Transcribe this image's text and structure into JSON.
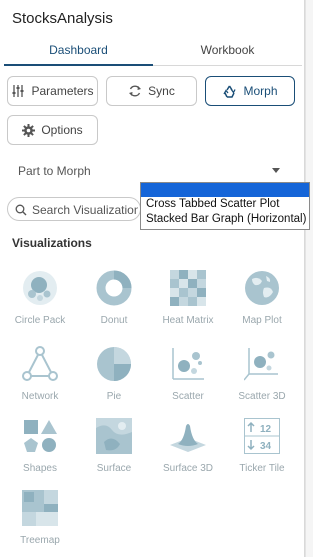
{
  "app": {
    "title": "StocksAnalysis"
  },
  "tabs": [
    {
      "label": "Dashboard",
      "active": true
    },
    {
      "label": "Workbook",
      "active": false
    }
  ],
  "toolbar": {
    "parameters_label": "Parameters",
    "sync_label": "Sync",
    "morph_label": "Morph",
    "options_label": "Options"
  },
  "morph": {
    "label": "Part to Morph",
    "options": [
      "Cross Tabbed Scatter Plot",
      "Stacked Bar Graph (Horizontal)"
    ]
  },
  "search": {
    "placeholder": "Search Visualization"
  },
  "visualizations": {
    "heading": "Visualizations",
    "items": [
      {
        "label": "Circle Pack",
        "icon": "circle-pack-icon"
      },
      {
        "label": "Donut",
        "icon": "donut-icon"
      },
      {
        "label": "Heat Matrix",
        "icon": "heat-matrix-icon"
      },
      {
        "label": "Map Plot",
        "icon": "map-plot-icon"
      },
      {
        "label": "Network",
        "icon": "network-icon"
      },
      {
        "label": "Pie",
        "icon": "pie-icon"
      },
      {
        "label": "Scatter",
        "icon": "scatter-icon"
      },
      {
        "label": "Scatter 3D",
        "icon": "scatter-3d-icon"
      },
      {
        "label": "Shapes",
        "icon": "shapes-icon"
      },
      {
        "label": "Surface",
        "icon": "surface-icon"
      },
      {
        "label": "Surface 3D",
        "icon": "surface-3d-icon"
      },
      {
        "label": "Ticker Tile",
        "icon": "ticker-tile-icon"
      },
      {
        "label": "Treemap",
        "icon": "treemap-icon"
      }
    ],
    "ticker_values": [
      "12",
      "34"
    ]
  },
  "colors": {
    "accent": "#1a4e77",
    "icon_fill": "#a9c4cf",
    "selection": "#1565d8"
  }
}
